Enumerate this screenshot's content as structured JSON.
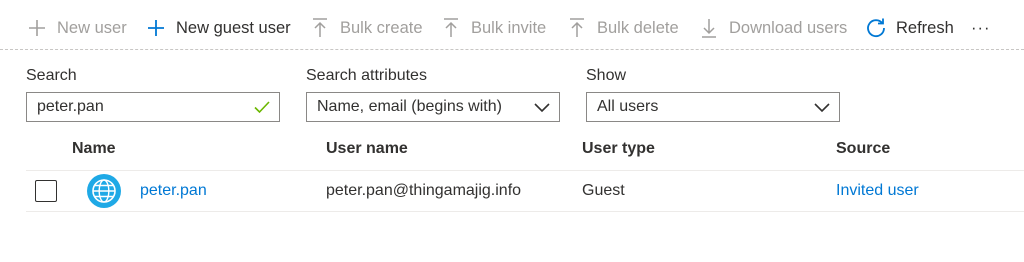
{
  "toolbar": {
    "new_user": "New user",
    "new_guest_user": "New guest user",
    "bulk_create": "Bulk create",
    "bulk_invite": "Bulk invite",
    "bulk_delete": "Bulk delete",
    "download_users": "Download users",
    "refresh": "Refresh",
    "more": "···"
  },
  "filters": {
    "search_label": "Search",
    "search_value": "peter.pan",
    "attributes_label": "Search attributes",
    "attributes_value": "Name, email (begins with)",
    "show_label": "Show",
    "show_value": "All users"
  },
  "table": {
    "columns": [
      "Name",
      "User name",
      "User type",
      "Source"
    ],
    "rows": [
      {
        "name": "peter.pan",
        "user_name": "peter.pan@thingamajig.info",
        "user_type": "Guest",
        "source": "Invited user"
      }
    ]
  },
  "colors": {
    "accent": "#0078d4",
    "disabled_text": "#a19f9d",
    "valid_check": "#6bb700",
    "avatar_fill": "#1fa9e6"
  },
  "icons": [
    "add-icon",
    "upload-icon",
    "delete-icon",
    "download-icon",
    "refresh-icon",
    "checkmark-icon",
    "chevron-down-icon",
    "globe-icon"
  ]
}
